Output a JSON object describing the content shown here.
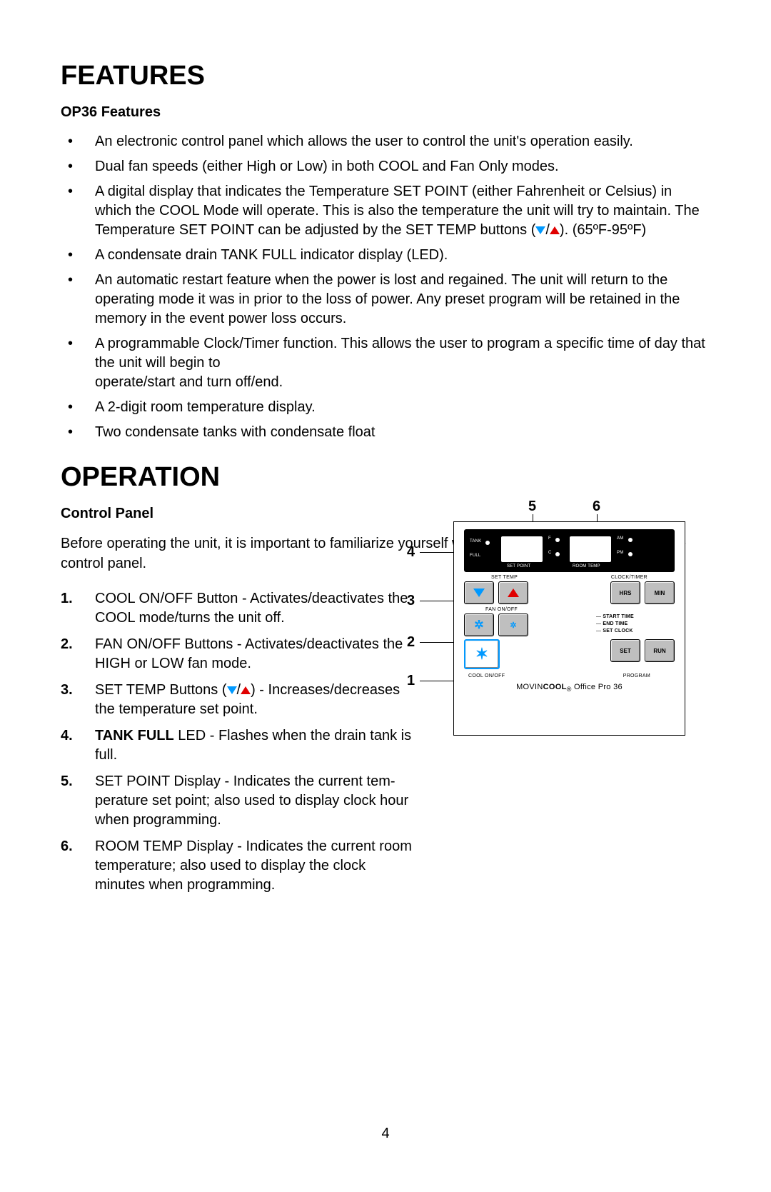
{
  "page_number": "4",
  "sections": {
    "features": {
      "title": "FEATURES",
      "subhead": "OP36 Features",
      "items": [
        "An electronic control panel which allows the user to control the unit's operation easily.",
        "Dual fan speeds (either High or Low) in both COOL and Fan Only modes.",
        "A digital display that indicates the Temperature SET POINT (either Fahrenheit or Celsius) in which the COOL Mode will operate.  This is also the temperature the unit will try to maintain.  The Temperature SET POINT can be adjusted by the SET TEMP buttons (",
        ").  (65ºF-95ºF)",
        "A condensate drain TANK FULL indicator display (LED).",
        "An automatic restart feature when the power is lost and regained.  The unit will return to the operating mode it was in prior to the loss of power.  Any preset program will be retained in the memory in the event power loss occurs.",
        "A programmable Clock/Timer function. This allows the user to program a specific time of day that the unit will begin to\noperate/start and turn off/end.",
        "A 2-digit room temperature display.",
        "Two condensate tanks with condensate float"
      ]
    },
    "operation": {
      "title": "OPERATION",
      "subhead": "Control Panel",
      "intro": "Before operating the unit, it is important to familiarize yourself with the basic controls located on the control panel.",
      "items": [
        {
          "n": "1.",
          "pre": "COOL ON/OFF Button - Activates/deactivates the COOL mode/turns the unit off."
        },
        {
          "n": "2.",
          "pre": "FAN ON/OFF Buttons - Activates/deactivates the HIGH or LOW fan mode."
        },
        {
          "n": "3.",
          "pre": "SET TEMP Buttons (",
          "post": ") -  Increases/decreas­es the temperature set point."
        },
        {
          "n": "4.",
          "bold": "TANK FULL",
          "post": " LED - Flashes when the drain tank is full."
        },
        {
          "n": "5.",
          "pre": "SET POINT Display - Indicates the current tem­perature set point; also used to display clock hour when programming."
        },
        {
          "n": "6.",
          "pre": "ROOM TEMP Display - Indicates the current room temperature; also used to display the clock minutes when programming."
        }
      ]
    }
  },
  "panel": {
    "callouts": {
      "c1": "1",
      "c2": "2",
      "c3": "3",
      "c4": "4",
      "c5": "5",
      "c6": "6"
    },
    "labels": {
      "tank": "TANK",
      "full": "FULL",
      "f": "F",
      "c": "C",
      "am": "AM",
      "pm": "PM",
      "setpoint": "SET POINT",
      "roomtemp": "ROOM TEMP",
      "settemp": "SET TEMP",
      "clocktimer": "CLOCK/TIMER",
      "hrs": "HRS",
      "min": "MIN",
      "fanonoff": "FAN ON/OFF",
      "starttime": "START TIME",
      "endtime": "END TIME",
      "setclock": "SET CLOCK",
      "set": "SET",
      "run": "RUN",
      "coolonoff": "COOL ON/OFF",
      "program": "PROGRAM",
      "model": "Office Pro 36",
      "brand1": "MOVIN",
      "brand2": "COOL"
    }
  }
}
